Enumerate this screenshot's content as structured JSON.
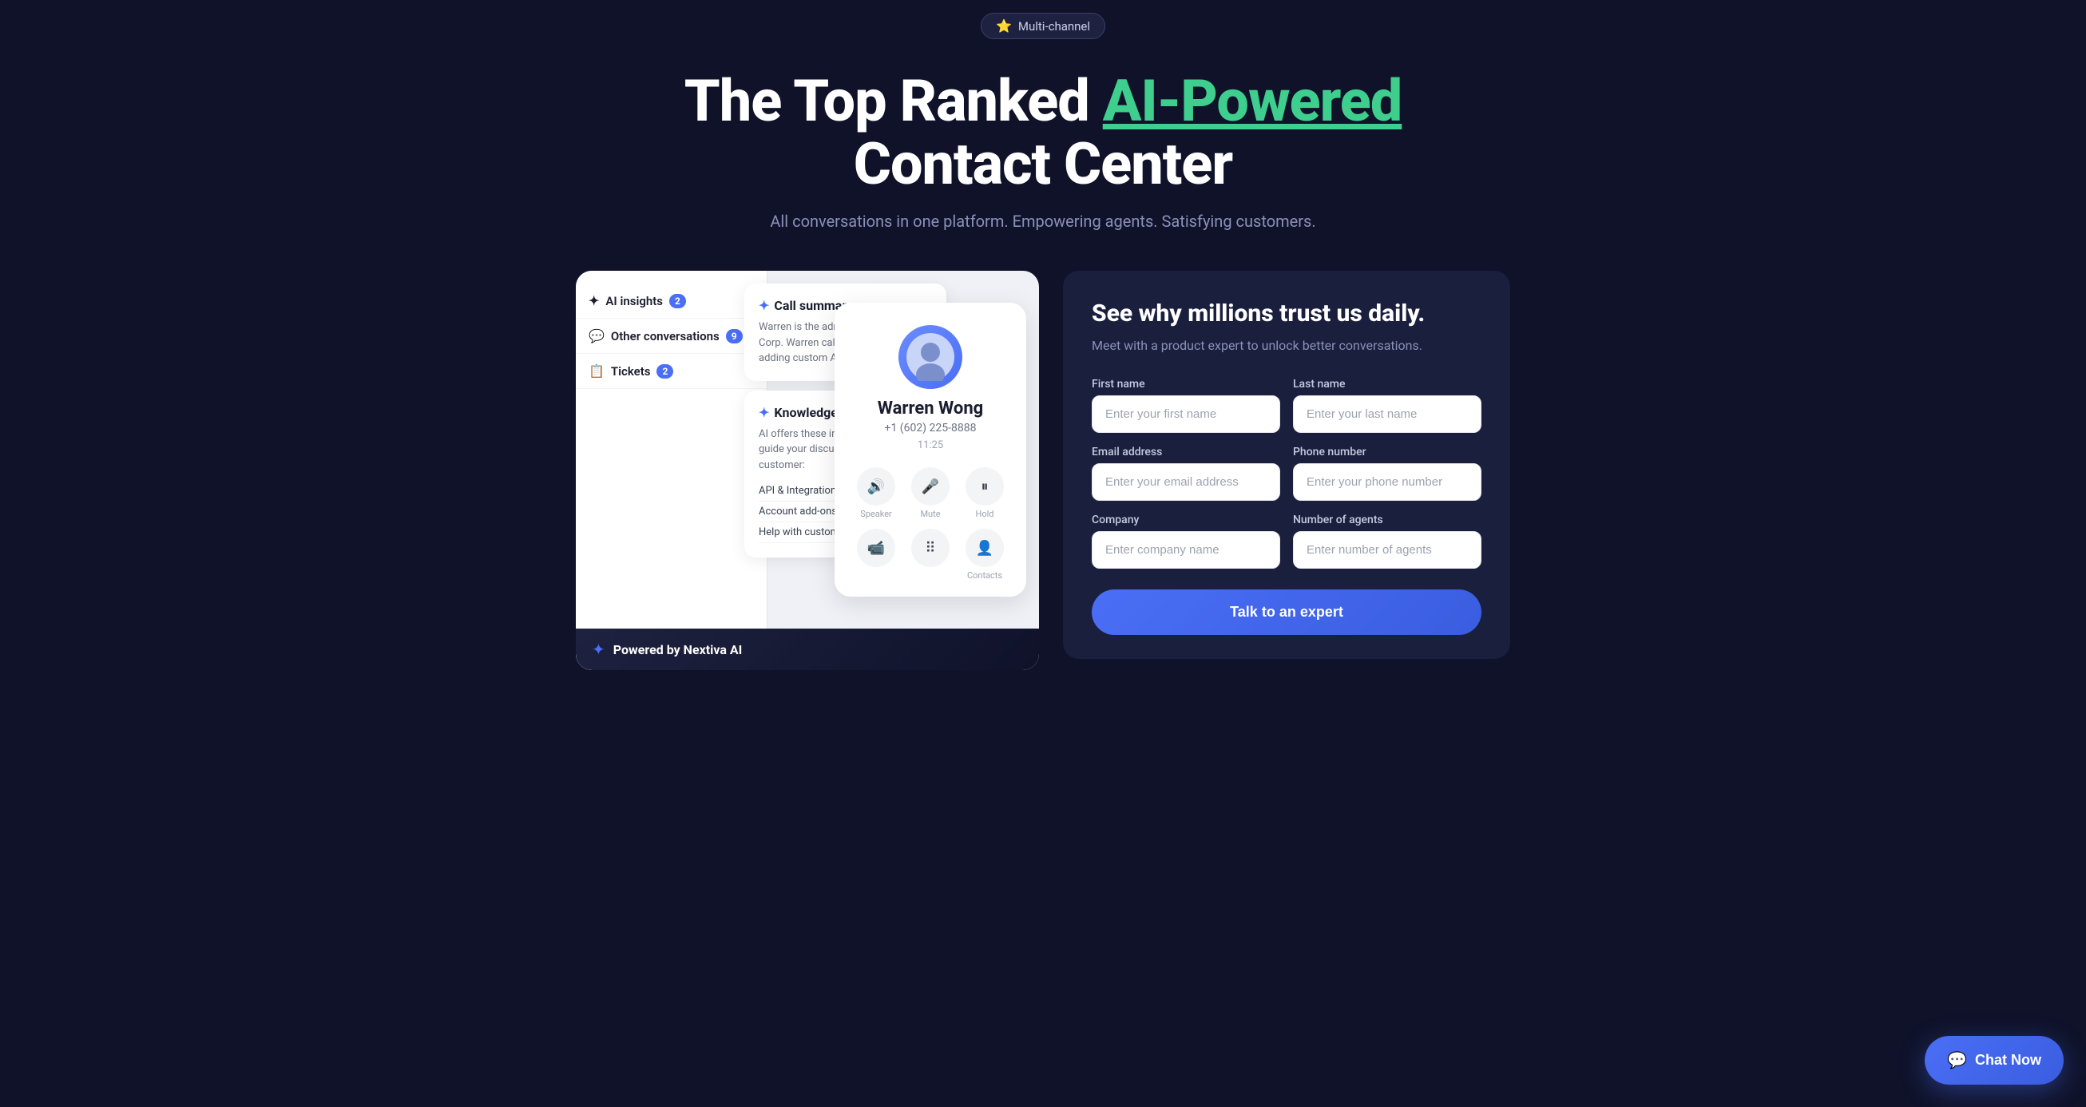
{
  "badge": {
    "icon": "⭐",
    "label": "Multi-channel"
  },
  "hero": {
    "heading_part1": "The Top Ranked ",
    "heading_highlight": "AI-Powered",
    "heading_part2": "Contact Center",
    "subtitle": "All conversations in one platform. Empowering agents. Satisfying customers."
  },
  "demo": {
    "sidebar_items": [
      {
        "icon": "✦",
        "label": "AI insights",
        "badge": "2"
      },
      {
        "icon": "💬",
        "label": "Other conversations",
        "badge": "9"
      },
      {
        "icon": "📋",
        "label": "Tickets",
        "badge": "2"
      }
    ],
    "call_summary": {
      "title": "Call summary",
      "text": "Warren is the admin from ACME Corp. Warren called to ask about adding custom API integratio..."
    },
    "knowledge_base": {
      "title": "Knowledge base",
      "text": "AI offers these internal articles to guide your discussion with the customer:",
      "items": [
        "API & Integrations",
        "Account add-ons",
        "Help with custom..."
      ]
    },
    "caller": {
      "name": "Warren Wong",
      "phone": "+1 (602) 225-8888",
      "time": "11:25",
      "avatar_emoji": "👤"
    },
    "controls": [
      {
        "icon": "🔊",
        "label": "Speaker"
      },
      {
        "icon": "🎤",
        "label": "Mute"
      },
      {
        "icon": "⏸",
        "label": "Hold"
      }
    ],
    "controls2": [
      {
        "icon": "📹",
        "label": ""
      },
      {
        "icon": "⠿",
        "label": ""
      },
      {
        "icon": "👤+",
        "label": "Contacts"
      }
    ],
    "powered_by": "Powered by Nextiva AI"
  },
  "form": {
    "title": "See why millions trust us daily.",
    "subtitle": "Meet with a product expert to unlock better conversations.",
    "fields": {
      "first_name_label": "First name",
      "first_name_placeholder": "Enter your first name",
      "last_name_label": "Last name",
      "last_name_placeholder": "Enter your last name",
      "email_label": "Email address",
      "email_placeholder": "Enter your email address",
      "phone_label": "Phone number",
      "phone_placeholder": "Enter your phone number",
      "company_label": "Company",
      "company_placeholder": "Enter company name",
      "agents_label": "Number of agents",
      "agents_placeholder": "Enter number of agents"
    },
    "submit_label": "Talk to an expert"
  },
  "chat_button": {
    "icon": "💬",
    "label": "Chat Now"
  }
}
